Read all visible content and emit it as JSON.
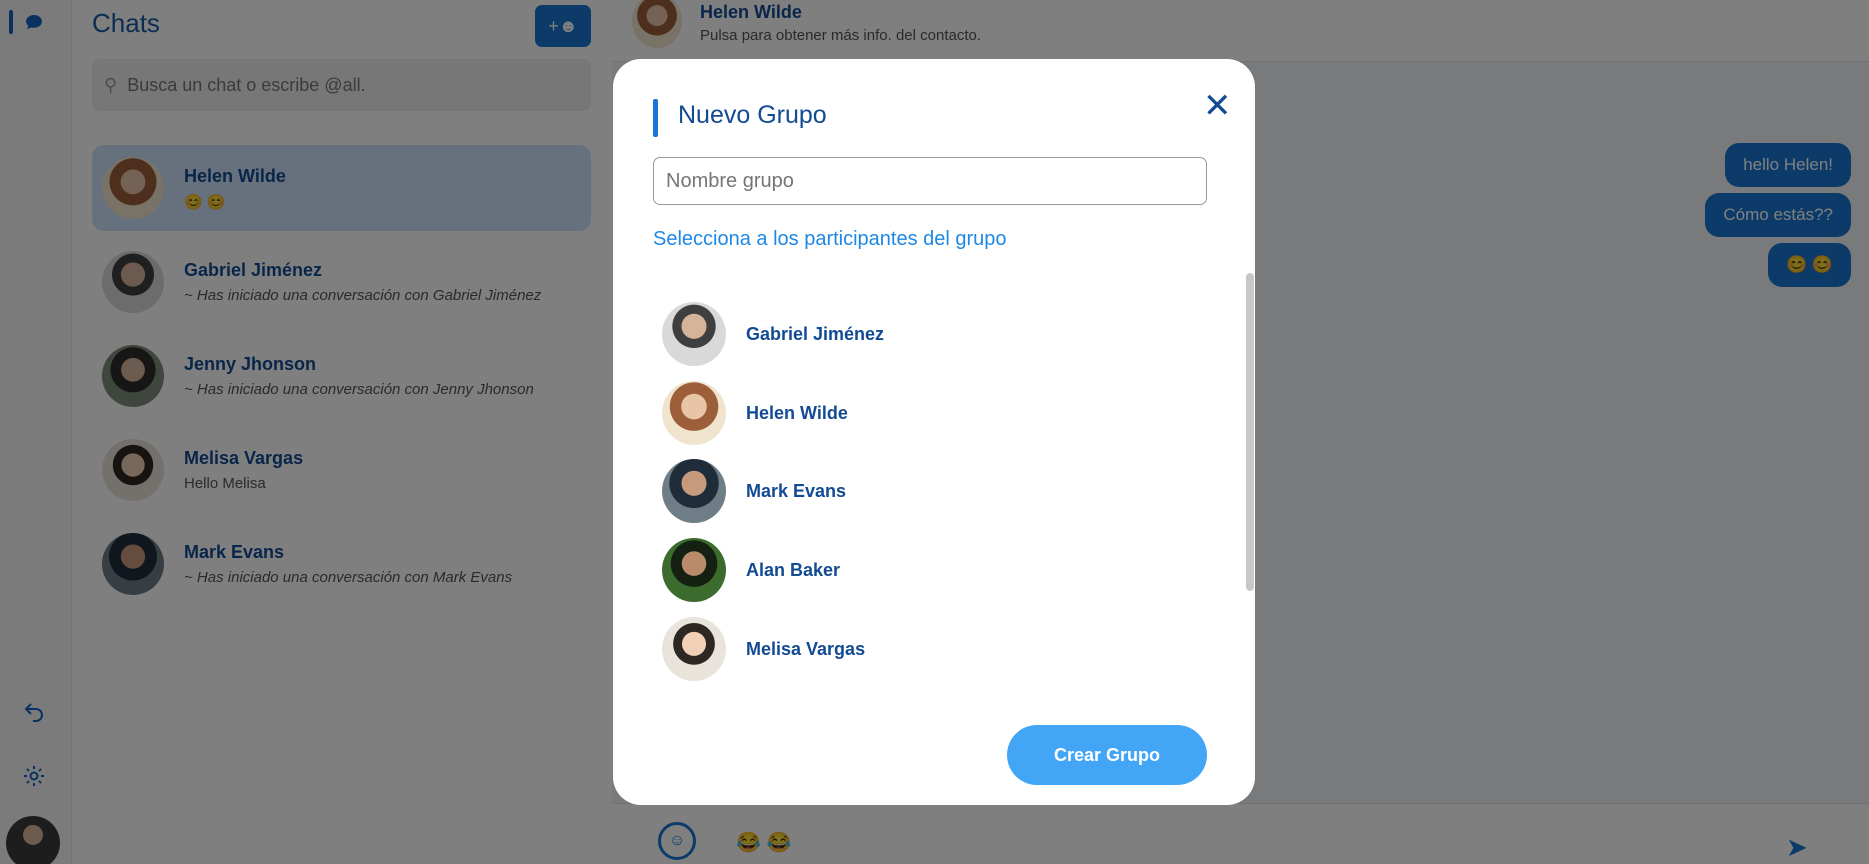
{
  "sidebar_rail": {
    "icons": [
      "chat-bubble-icon",
      "undo-icon",
      "gear-icon"
    ]
  },
  "chat_list": {
    "title": "Chats",
    "add_button_icon": "add-user-icon",
    "search_placeholder": "Busca un chat o escribe @all.",
    "chats": [
      {
        "name": "Helen Wilde",
        "preview": "😊 😊",
        "active": true
      },
      {
        "name": "Gabriel Jiménez",
        "preview": "~ Has iniciado una conversación con Gabriel Jiménez"
      },
      {
        "name": "Jenny Jhonson",
        "preview": "~ Has iniciado una conversación con Jenny Jhonson"
      },
      {
        "name": "Melisa Vargas",
        "preview": "Hello Melisa"
      },
      {
        "name": "Mark Evans",
        "preview": "~ Has iniciado una conversación con Mark Evans"
      }
    ]
  },
  "conversation": {
    "contact_name": "Helen Wilde",
    "contact_hint": "Pulsa para obtener más info. del contacto.",
    "messages": [
      "hello Helen!",
      "Cómo estás??",
      "😊 😊"
    ],
    "composer_text": "😂 😂",
    "emoji_icon": "smiley-icon",
    "send_icon": "send-icon"
  },
  "modal": {
    "title": "Nuevo Grupo",
    "name_placeholder": "Nombre grupo",
    "subtitle": "Selecciona a los participantes del grupo",
    "participants": [
      "Gabriel Jiménez",
      "Helen Wilde",
      "Mark Evans",
      "Alan Baker",
      "Melisa Vargas"
    ],
    "create_label": "Crear Grupo",
    "close_icon": "close-icon"
  },
  "colors": {
    "accent": "#1976d2",
    "title": "#124a93",
    "button": "#42a5f5"
  }
}
